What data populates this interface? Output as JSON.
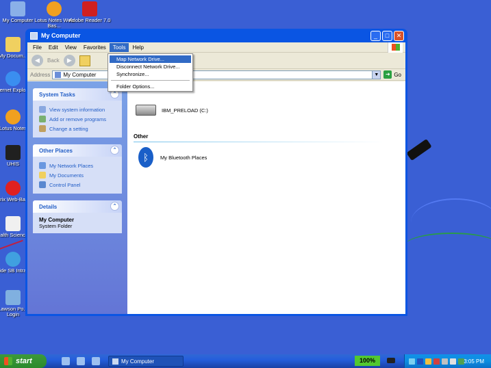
{
  "desktop": {
    "icons": [
      {
        "label": "My Computer",
        "color": "#8ab0e8"
      },
      {
        "label": "Lotus Notes Web Bas...",
        "color": "#f0a020"
      },
      {
        "label": "Adobe Reader 7.0",
        "color": "#d02020"
      },
      {
        "label": "My Docum...",
        "color": "#f0d060"
      },
      {
        "label": "Internet Explorer",
        "color": "#3a8ef0"
      },
      {
        "label": "Lotus Notes",
        "color": "#f0a020"
      },
      {
        "label": "UHIS",
        "color": "#202020"
      },
      {
        "label": "Citrix Web-Bas...",
        "color": "#e02020"
      },
      {
        "label": "Health Science...",
        "color": "#f0f0f0"
      },
      {
        "label": "Inside SB Intranet",
        "color": "#40a0e0"
      },
      {
        "label": "Lawson Po... Login",
        "color": "#80b0e0"
      }
    ]
  },
  "window": {
    "title": "My Computer",
    "controls": {
      "minimize": "_",
      "maximize": "□",
      "close": "✕"
    },
    "menu": [
      "File",
      "Edit",
      "View",
      "Favorites",
      "Tools",
      "Help"
    ],
    "toolbar": {
      "back": "Back"
    },
    "address": {
      "label": "Address",
      "value": "My Computer",
      "go": "Go"
    },
    "tools_menu": [
      "Map Network Drive...",
      "Disconnect Network Drive...",
      "Synchronize...",
      "Folder Options..."
    ]
  },
  "tasks": {
    "system": {
      "title": "System Tasks",
      "links": [
        "View system information",
        "Add or remove programs",
        "Change a setting"
      ]
    },
    "other_places": {
      "title": "Other Places",
      "links": [
        "My Network Places",
        "My Documents",
        "Control Panel"
      ]
    },
    "details": {
      "title": "Details",
      "name": "My Computer",
      "type": "System Folder"
    }
  },
  "main": {
    "drive_label": "IBM_PRELOAD (C:)",
    "other_group": "Other",
    "bluetooth_label": "My Bluetooth Places"
  },
  "taskbar": {
    "start": "start",
    "task_button": "My Computer",
    "battery": "100%",
    "clock": "3:05 PM"
  }
}
